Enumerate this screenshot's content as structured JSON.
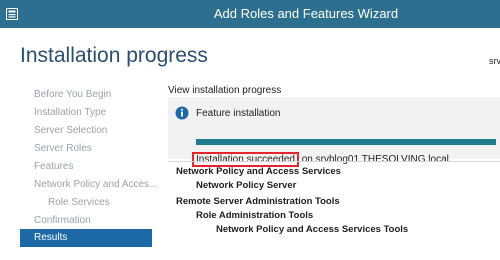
{
  "window": {
    "title": "Add Roles and Features Wizard",
    "accent_color": "#2c6f8e",
    "app_icon": "server-manager-icon"
  },
  "header": {
    "page_title": "Installation progress",
    "server": "srvb"
  },
  "sidebar": {
    "items": [
      {
        "label": "Before You Begin",
        "state": "disabled"
      },
      {
        "label": "Installation Type",
        "state": "disabled"
      },
      {
        "label": "Server Selection",
        "state": "disabled"
      },
      {
        "label": "Server Roles",
        "state": "disabled"
      },
      {
        "label": "Features",
        "state": "disabled"
      },
      {
        "label": "Network Policy and Acces...",
        "state": "disabled"
      },
      {
        "label": "Role Services",
        "state": "disabled"
      },
      {
        "label": "Confirmation",
        "state": "disabled"
      },
      {
        "label": "Results",
        "state": "active"
      }
    ],
    "active_color": "#1c69a6"
  },
  "content": {
    "view_label": "View installation progress",
    "feature_label": "Feature installation",
    "info_icon": "info-icon",
    "progress": 1.0,
    "progress_color": "#1f7a8c",
    "status_highlight": "Installation succeeded",
    "status_rest": " on srvblog01.THESOLVING.local.",
    "highlight_color": "#e3262d"
  },
  "results": {
    "items": [
      {
        "label": "Network Policy and Access Services",
        "level": 0
      },
      {
        "label": "Network Policy Server",
        "level": 1
      },
      {
        "label": "Remote Server Administration Tools",
        "level": 0
      },
      {
        "label": "Role Administration Tools",
        "level": 1
      },
      {
        "label": "Network Policy and Access Services Tools",
        "level": 2
      }
    ]
  }
}
